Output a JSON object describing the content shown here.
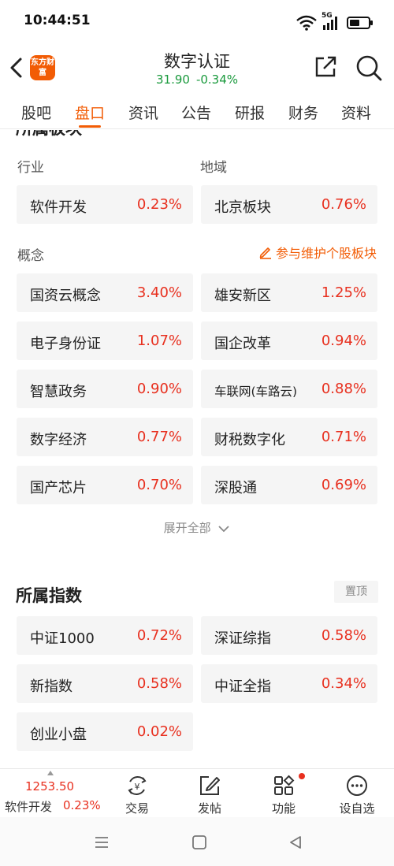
{
  "status_bar": {
    "time": "10:44:51",
    "network": "5G"
  },
  "header": {
    "logo_text": "东方财富",
    "title": "数字认证",
    "price": "31.90",
    "change_pct": "-0.34%"
  },
  "tabs": [
    {
      "label": "股吧"
    },
    {
      "label": "盘口"
    },
    {
      "label": "资讯"
    },
    {
      "label": "公告"
    },
    {
      "label": "研报"
    },
    {
      "label": "财务"
    },
    {
      "label": "资料"
    }
  ],
  "sections": {
    "cut_heading": "所属板块",
    "industry_label": "行业",
    "region_label": "地域",
    "concept_label": "概念",
    "maintain_link": "参与维护个股板块",
    "expand_all": "展开全部",
    "index_title": "所属指数",
    "pin_top": "置顶"
  },
  "industry": {
    "name": "软件开发",
    "pct": "0.23%"
  },
  "region": {
    "name": "北京板块",
    "pct": "0.76%"
  },
  "concepts": [
    {
      "name": "国资云概念",
      "pct": "3.40%"
    },
    {
      "name": "雄安新区",
      "pct": "1.25%"
    },
    {
      "name": "电子身份证",
      "pct": "1.07%"
    },
    {
      "name": "国企改革",
      "pct": "0.94%"
    },
    {
      "name": "智慧政务",
      "pct": "0.90%"
    },
    {
      "name": "车联网(车路云)",
      "pct": "0.88%"
    },
    {
      "name": "数字经济",
      "pct": "0.77%"
    },
    {
      "name": "财税数字化",
      "pct": "0.71%"
    },
    {
      "name": "国产芯片",
      "pct": "0.70%"
    },
    {
      "name": "深股通",
      "pct": "0.69%"
    }
  ],
  "indices": [
    {
      "name": "中证1000",
      "pct": "0.72%"
    },
    {
      "name": "深证综指",
      "pct": "0.58%"
    },
    {
      "name": "新指数",
      "pct": "0.58%"
    },
    {
      "name": "中证全指",
      "pct": "0.34%"
    },
    {
      "name": "创业小盘",
      "pct": "0.02%"
    }
  ],
  "bottom_bar": {
    "stock_price": "1253.50",
    "stock_name": "软件开发",
    "stock_pct": "0.23%",
    "items": [
      {
        "label": "交易",
        "icon": "trade-icon"
      },
      {
        "label": "发帖",
        "icon": "post-icon"
      },
      {
        "label": "功能",
        "icon": "function-icon"
      },
      {
        "label": "设自选",
        "icon": "watchlist-icon"
      }
    ]
  },
  "colors": {
    "accent": "#f25c05",
    "up": "#e8301f",
    "down": "#1a9a3d"
  }
}
